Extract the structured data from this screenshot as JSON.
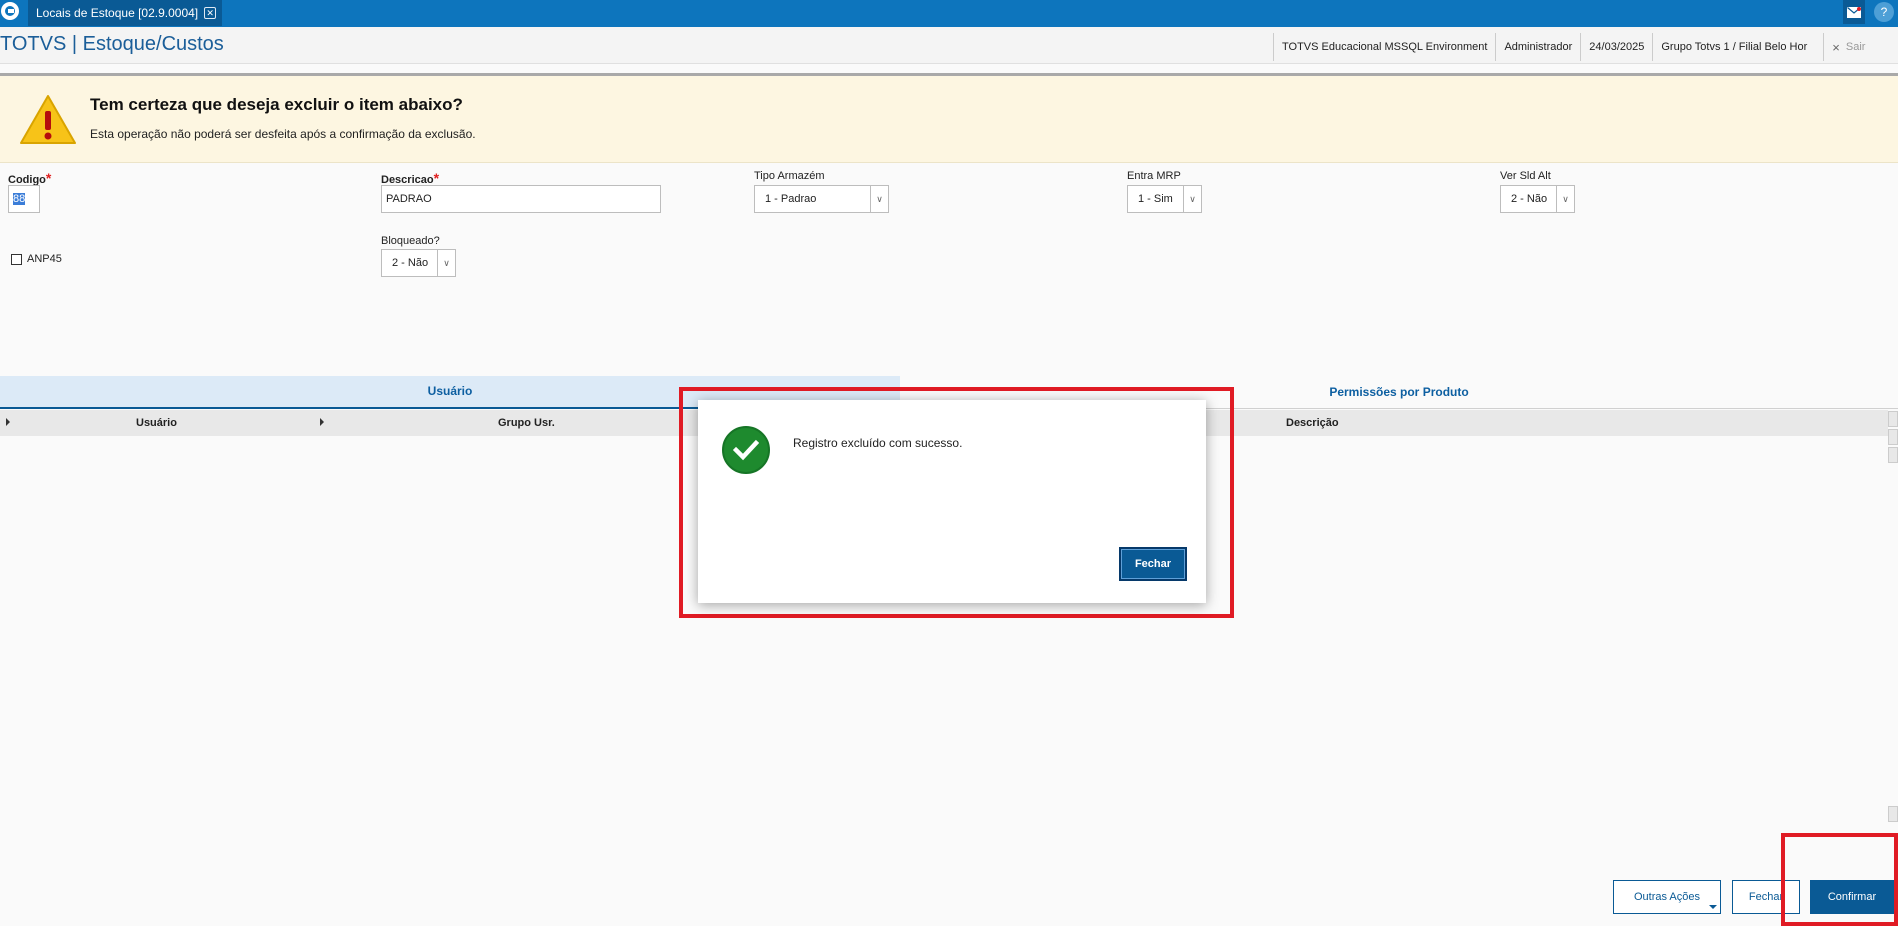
{
  "window": {
    "tab_title": "Locais de Estoque [02.9.0004]",
    "tab_close": "✕",
    "icons": [
      "totvs-logo-icon",
      "mail-icon",
      "help-icon"
    ]
  },
  "header": {
    "app_title": "TOTVS | Estoque/Custos",
    "environment": "TOTVS Educacional MSSQL Environment",
    "user": "Administrador",
    "date": "24/03/2025",
    "branch": "Grupo Totvs 1 / Filial Belo Hor",
    "exit_label": "Sair",
    "exit_icon": "×"
  },
  "warning": {
    "title": "Tem certeza que deseja excluir o item abaixo?",
    "subtitle": "Esta operação não poderá ser desfeita após a confirmação da exclusão."
  },
  "form": {
    "codigo": {
      "label": "Codigo",
      "value": "88",
      "required": "*"
    },
    "descricao": {
      "label": "Descricao",
      "value": "PADRAO",
      "required": "*"
    },
    "tipo_armazem": {
      "label": "Tipo Armazém",
      "value": "1 - Padrao"
    },
    "entra_mrp": {
      "label": "Entra MRP",
      "value": "1 - Sim"
    },
    "ver_sld_alt": {
      "label": "Ver Sld Alt",
      "value": "2 - Não"
    },
    "anp45": {
      "label": "ANP45",
      "checked": false
    },
    "bloqueado": {
      "label": "Bloqueado?",
      "value": "2 - Não"
    }
  },
  "tabs": [
    {
      "label": "Usuário",
      "active": true
    },
    {
      "label": "Permissões por Produto",
      "active": false
    }
  ],
  "grid": {
    "columns": [
      "Usuário",
      "Grupo Usr.",
      "Descrição"
    ]
  },
  "modal": {
    "message": "Registro excluído com sucesso.",
    "close_label": "Fechar",
    "icon": "success-check-icon"
  },
  "buttons": {
    "outras_acoes": "Outras Ações",
    "fechar": "Fechar",
    "confirmar": "Confirmar"
  },
  "colors": {
    "topbar": "#0d75bd",
    "primary": "#0a5a95",
    "title": "#1b5e99",
    "warning_bg": "#fdf6e1",
    "success": "#1e8a2e",
    "highlight_box": "#e01b24",
    "required": "#e02020"
  }
}
